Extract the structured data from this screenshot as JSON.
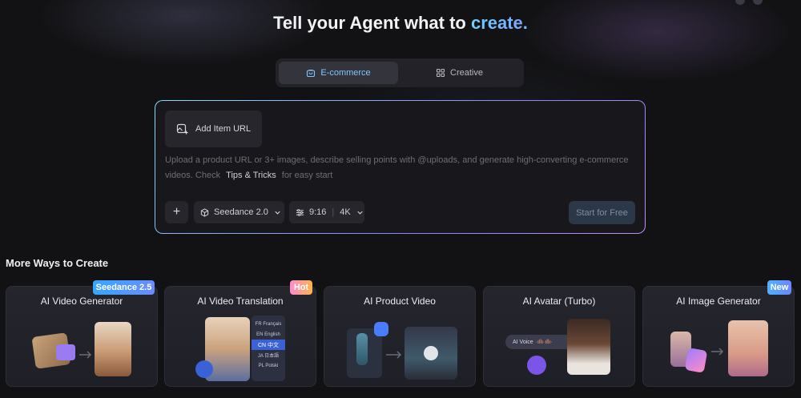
{
  "hero": {
    "title_prefix": "Tell your Agent what to ",
    "title_accent": "create",
    "title_suffix": "."
  },
  "tabs": [
    {
      "label": "E-commerce",
      "icon": "bag-icon",
      "active": true
    },
    {
      "label": "Creative",
      "icon": "grid-icon",
      "active": false
    }
  ],
  "prompt": {
    "add_url_label": "Add Item URL",
    "placeholder_before": "Upload a product URL or 3+ images, describe selling points with @uploads, and generate high-converting e-commerce videos. Check ",
    "tips_link": "Tips & Tricks",
    "placeholder_after": " for easy start",
    "plus_label": "+",
    "model_label": "Seedance 2.0",
    "ratio_label": "9:16",
    "resolution_label": "4K",
    "start_label": "Start for Free"
  },
  "section": {
    "title": "More Ways to Create"
  },
  "cards": [
    {
      "title": "AI Video Generator",
      "badge": "Seedance 2.5"
    },
    {
      "title": "AI Video Translation",
      "badge": "Hot",
      "languages": [
        "FR Français",
        "EN English",
        "CN 中文",
        "JA 日本語",
        "PL Polski"
      ]
    },
    {
      "title": "AI Product Video",
      "badge": ""
    },
    {
      "title": "AI Avatar (Turbo)",
      "badge": "",
      "voice_label": "AI Voice"
    },
    {
      "title": "AI Image Generator",
      "badge": "New"
    }
  ],
  "colors": {
    "accent": "#6fd0ff",
    "background": "#121214",
    "border_gradient_start": "#7de0ff",
    "border_gradient_end": "#c58bff"
  }
}
